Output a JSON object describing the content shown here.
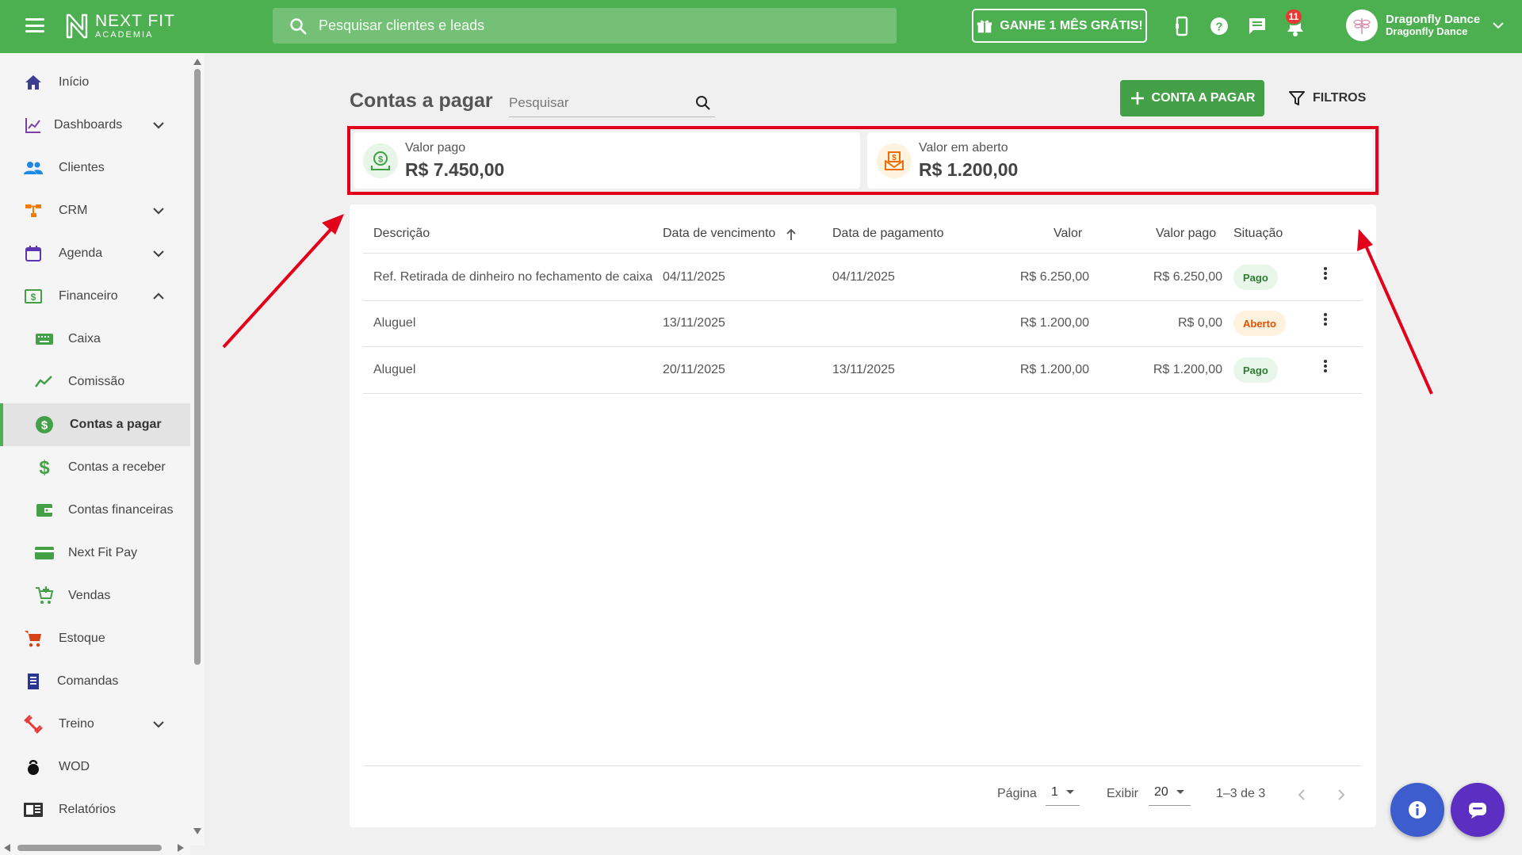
{
  "topbar": {
    "logo_main": "NEXT FIT",
    "logo_sub": "ACADEMIA",
    "search_placeholder": "Pesquisar clientes e leads",
    "promo_label": "GANHE 1 MÊS GRÁTIS!",
    "notification_count": "11",
    "user_name": "Dragonfly Dance",
    "user_sub": "Dragonfly Dance"
  },
  "sidebar": {
    "items": [
      {
        "label": "Início",
        "icon": "home-icon"
      },
      {
        "label": "Dashboards",
        "icon": "chart-line-icon"
      },
      {
        "label": "Clientes",
        "icon": "people-icon"
      },
      {
        "label": "CRM",
        "icon": "sitemap-icon"
      },
      {
        "label": "Agenda",
        "icon": "calendar-icon"
      },
      {
        "label": "Financeiro",
        "icon": "money-icon"
      },
      {
        "label": "Caixa",
        "icon": "keyboard-icon"
      },
      {
        "label": "Comissão",
        "icon": "trend-icon"
      },
      {
        "label": "Contas a pagar",
        "icon": "dollar-circle-icon"
      },
      {
        "label": "Contas a receber",
        "icon": "dollar-icon"
      },
      {
        "label": "Contas financeiras",
        "icon": "wallet-icon"
      },
      {
        "label": "Next Fit Pay",
        "icon": "credit-card-icon"
      },
      {
        "label": "Vendas",
        "icon": "cart-plus-icon"
      },
      {
        "label": "Estoque",
        "icon": "cart-icon"
      },
      {
        "label": "Comandas",
        "icon": "receipt-icon"
      },
      {
        "label": "Treino",
        "icon": "dumbbell-icon"
      },
      {
        "label": "WOD",
        "icon": "kettlebell-icon"
      },
      {
        "label": "Relatórios",
        "icon": "report-icon"
      }
    ]
  },
  "main": {
    "title": "Contas a pagar",
    "search_placeholder": "Pesquisar",
    "add_button": "CONTA A PAGAR",
    "filter_button": "FILTROS",
    "summary": {
      "paid_label": "Valor pago",
      "paid_value": "R$ 7.450,00",
      "open_label": "Valor em aberto",
      "open_value": "R$ 1.200,00"
    },
    "table": {
      "headers": [
        "Descrição",
        "Data de vencimento",
        "Data de pagamento",
        "Valor",
        "Valor pago",
        "Situação"
      ],
      "rows": [
        {
          "descricao": "Ref. Retirada de dinheiro no fechamento de caixa",
          "vencimento": "04/11/2025",
          "pagamento": "04/11/2025",
          "valor": "R$ 6.250,00",
          "valor_pago": "R$ 6.250,00",
          "situacao": "Pago"
        },
        {
          "descricao": "Aluguel",
          "vencimento": "13/11/2025",
          "pagamento": "",
          "valor": "R$ 1.200,00",
          "valor_pago": "R$ 0,00",
          "situacao": "Aberto"
        },
        {
          "descricao": "Aluguel",
          "vencimento": "20/11/2025",
          "pagamento": "13/11/2025",
          "valor": "R$ 1.200,00",
          "valor_pago": "R$ 1.200,00",
          "situacao": "Pago"
        }
      ]
    },
    "pagination": {
      "page_label": "Página",
      "page_value": "1",
      "show_label": "Exibir",
      "show_value": "20",
      "range": "1–3 de 3"
    }
  },
  "colors": {
    "brand": "#4caf50",
    "annotation": "#e3001b",
    "paid": "#2e7d32",
    "open": "#e65100"
  }
}
